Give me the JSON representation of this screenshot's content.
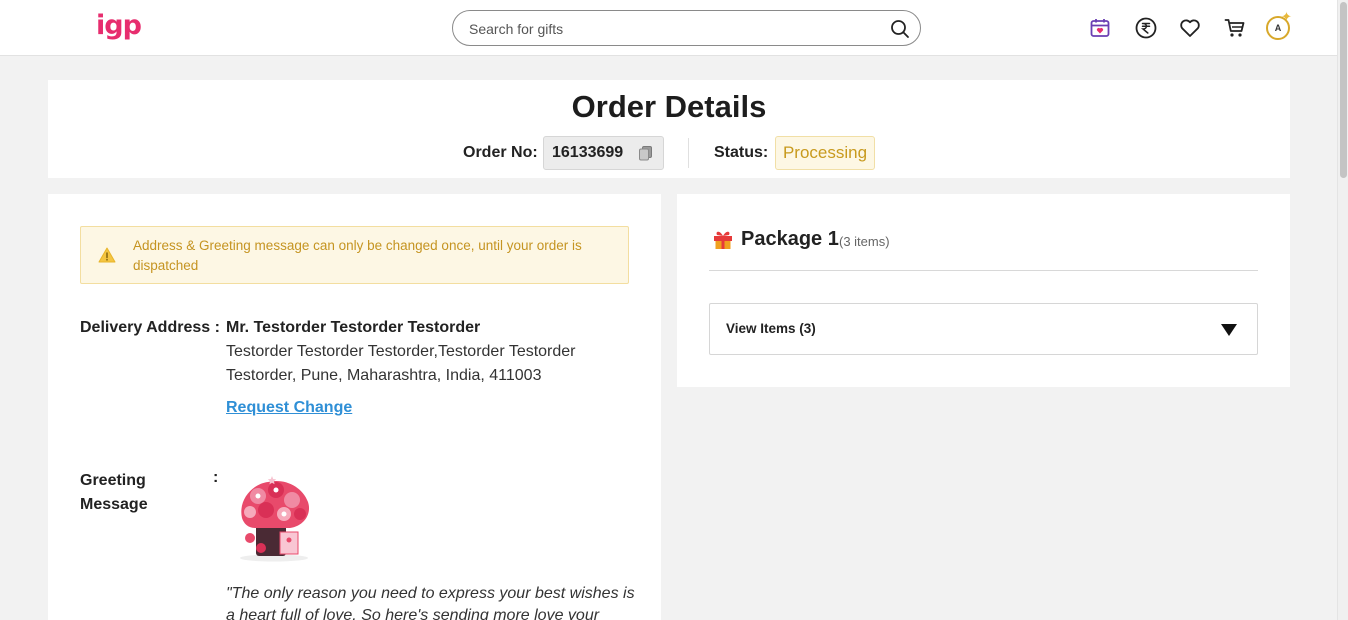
{
  "header": {
    "logo": "igp",
    "search_placeholder": "Search for gifts",
    "avatar_initial": "A",
    "icons": [
      "calendar-heart-icon",
      "rupee-icon",
      "heart-icon",
      "cart-icon",
      "avatar-icon"
    ]
  },
  "order": {
    "title": "Order Details",
    "order_no_label": "Order No:",
    "order_no": "16133699",
    "status_label": "Status:",
    "status": "Processing"
  },
  "left": {
    "notice": "Address & Greeting message can only be changed once, until your order is dispatched",
    "delivery_label": "Delivery Address :",
    "recipient_name": "Mr. Testorder Testorder Testorder",
    "address": "Testorder Testorder Testorder,Testorder Testorder Testorder, Pune, Maharashtra, India, 411003",
    "request_change": "Request Change",
    "greeting_label": "Greeting Message",
    "greeting_colon": ":",
    "greeting_text": "\"The only reason you need to express your best wishes is a heart full of love. So here's sending more love your"
  },
  "right": {
    "package_title": "Package 1",
    "package_count": "(3 items)",
    "view_items": "View Items (3)"
  },
  "colors": {
    "brand": "#e72d6e",
    "status_text": "#c89a1e",
    "status_bg": "#fdf7e4",
    "link": "#2f8fd6"
  }
}
